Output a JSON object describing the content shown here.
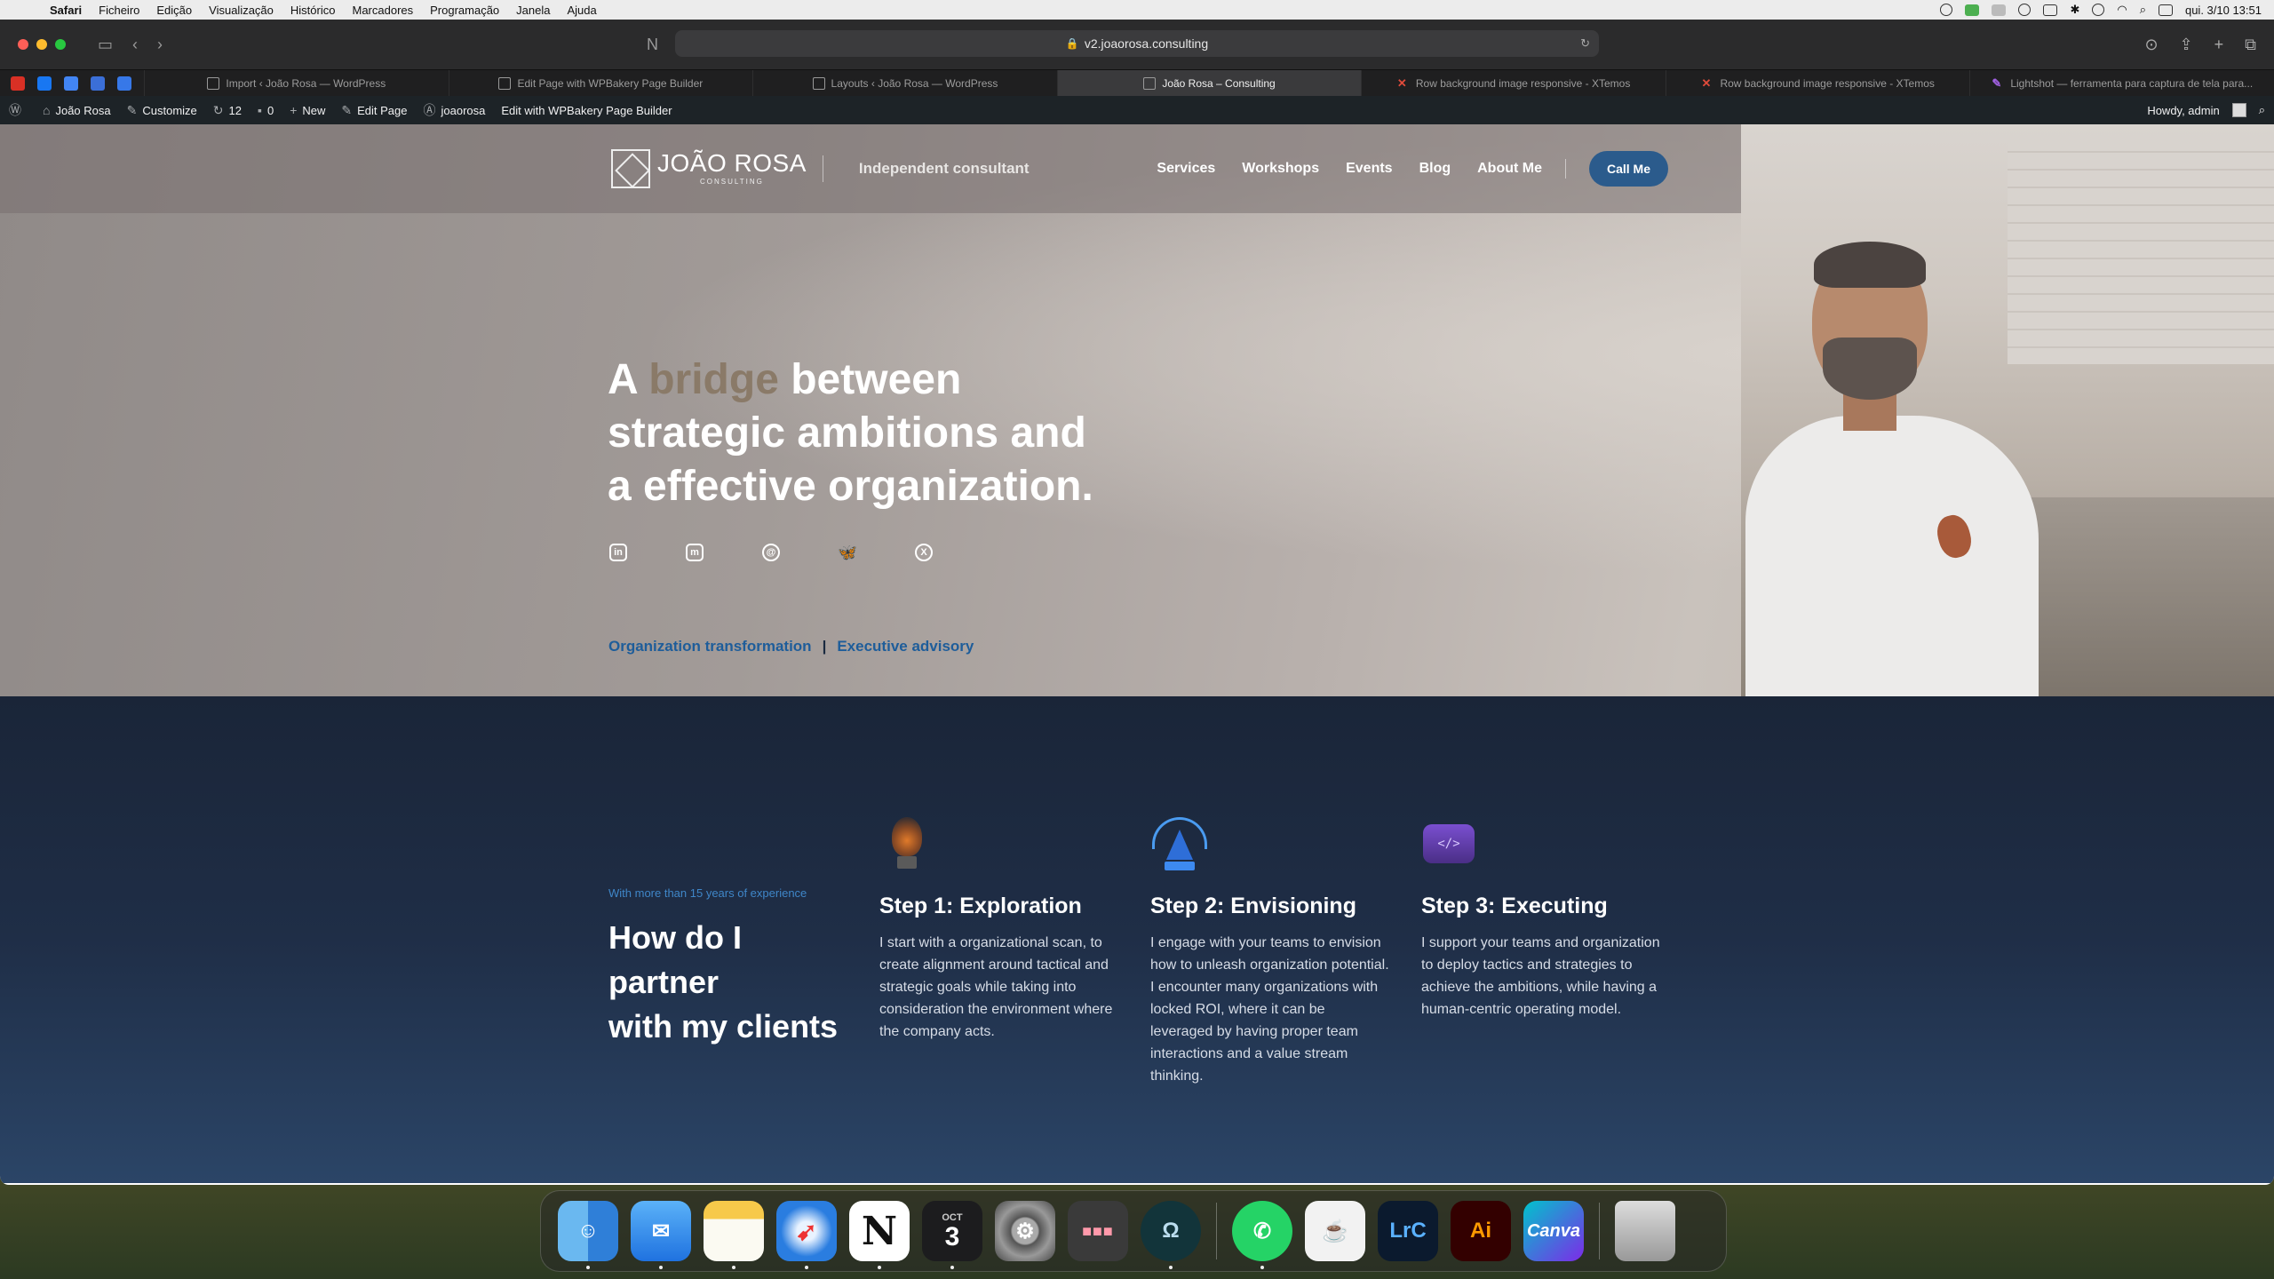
{
  "menubar": {
    "app": "Safari",
    "items": [
      "Ficheiro",
      "Edição",
      "Visualização",
      "Histórico",
      "Marcadores",
      "Programação",
      "Janela",
      "Ajuda"
    ],
    "clock": "qui. 3/10  13:51"
  },
  "browser": {
    "url": "v2.joaorosa.consulting",
    "tabs": [
      {
        "label": "Import ‹ João Rosa — WordPress",
        "active": false
      },
      {
        "label": "Edit Page with WPBakery Page Builder",
        "active": false
      },
      {
        "label": "Layouts ‹ João Rosa — WordPress",
        "active": false
      },
      {
        "label": "João Rosa – Consulting",
        "active": true
      },
      {
        "label": "Row background image responsive - XTemos",
        "active": false
      },
      {
        "label": "Row background image responsive - XTemos",
        "active": false
      },
      {
        "label": "Lightshot — ferramenta para captura de tela para...",
        "active": false
      }
    ]
  },
  "adminbar": {
    "site": "João Rosa",
    "customize": "Customize",
    "updates": "12",
    "comments": "0",
    "new": "New",
    "edit_page": "Edit Page",
    "user_plugin": "joaorosa",
    "wpbakery": "Edit with WPBakery Page Builder",
    "howdy": "Howdy, admin"
  },
  "site": {
    "logo_text": "JOÃO ROSA",
    "logo_sub": "CONSULTING",
    "tagline": "Independent consultant",
    "nav": [
      "Services",
      "Workshops",
      "Events",
      "Blog",
      "About Me"
    ],
    "cta": "Call Me"
  },
  "hero": {
    "line1_pre": "A ",
    "line1_accent": "bridge",
    "line1_post": " between",
    "line2": "strategic ambitions and",
    "line3": "a effective organization.",
    "socials": [
      "linkedin-icon",
      "mastodon-icon",
      "threads-icon",
      "bluesky-icon",
      "x-icon"
    ],
    "link1": "Organization transformation",
    "link_sep": "|",
    "link2": "Executive advisory",
    "accent_color": "#8a7a68"
  },
  "steps": {
    "kicker": "With more than 15 years of experience",
    "title_l1": "How do I",
    "title_l2": "partner",
    "title_l3": "with my clients",
    "items": [
      {
        "title": "Step 1: Exploration",
        "text": "I start with a organizational scan, to create alignment around tactical and strategic goals while taking into consideration the environment where the company acts."
      },
      {
        "title": "Step 2: Envisioning",
        "text": "I engage with your teams to envision how to unleash organization potential. I encounter many organizations with locked ROI, where it can be leveraged by having proper team interactions and a value stream thinking."
      },
      {
        "title": "Step 3: Executing",
        "text": "I support your teams and organization to deploy tactics and strategies to achieve the ambitions, while having a human-centric operating model."
      }
    ]
  },
  "dock": {
    "calendar_month": "OCT",
    "calendar_day": "3",
    "lrc": "LrC",
    "ai": "Ai",
    "canva": "Canva"
  }
}
